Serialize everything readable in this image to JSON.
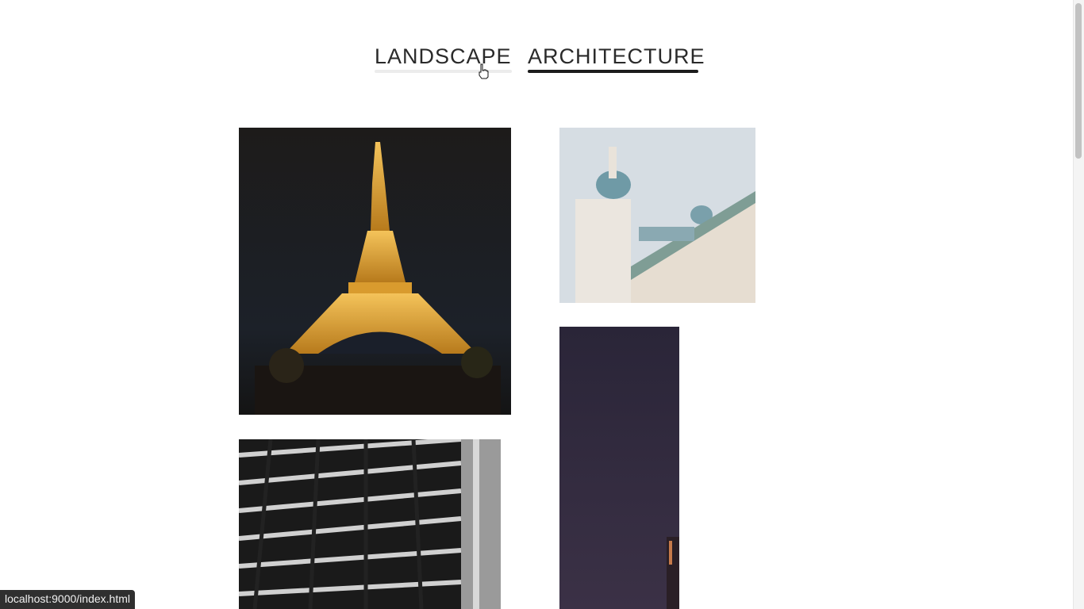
{
  "tabs": [
    {
      "label": "LANDSCAPE",
      "active": false
    },
    {
      "label": "ARCHITECTURE",
      "active": true
    }
  ],
  "gallery": {
    "images": [
      {
        "subject": "eiffel-tower-night"
      },
      {
        "subject": "palace-domes"
      },
      {
        "subject": "glass-roof-bw"
      },
      {
        "subject": "tower-at-dusk"
      }
    ]
  },
  "status_bar": {
    "url": "localhost:9000/index.html"
  },
  "colors": {
    "text": "#2a2a2a",
    "active_underline": "#1c1c1c",
    "inactive_underline": "#ececec"
  }
}
